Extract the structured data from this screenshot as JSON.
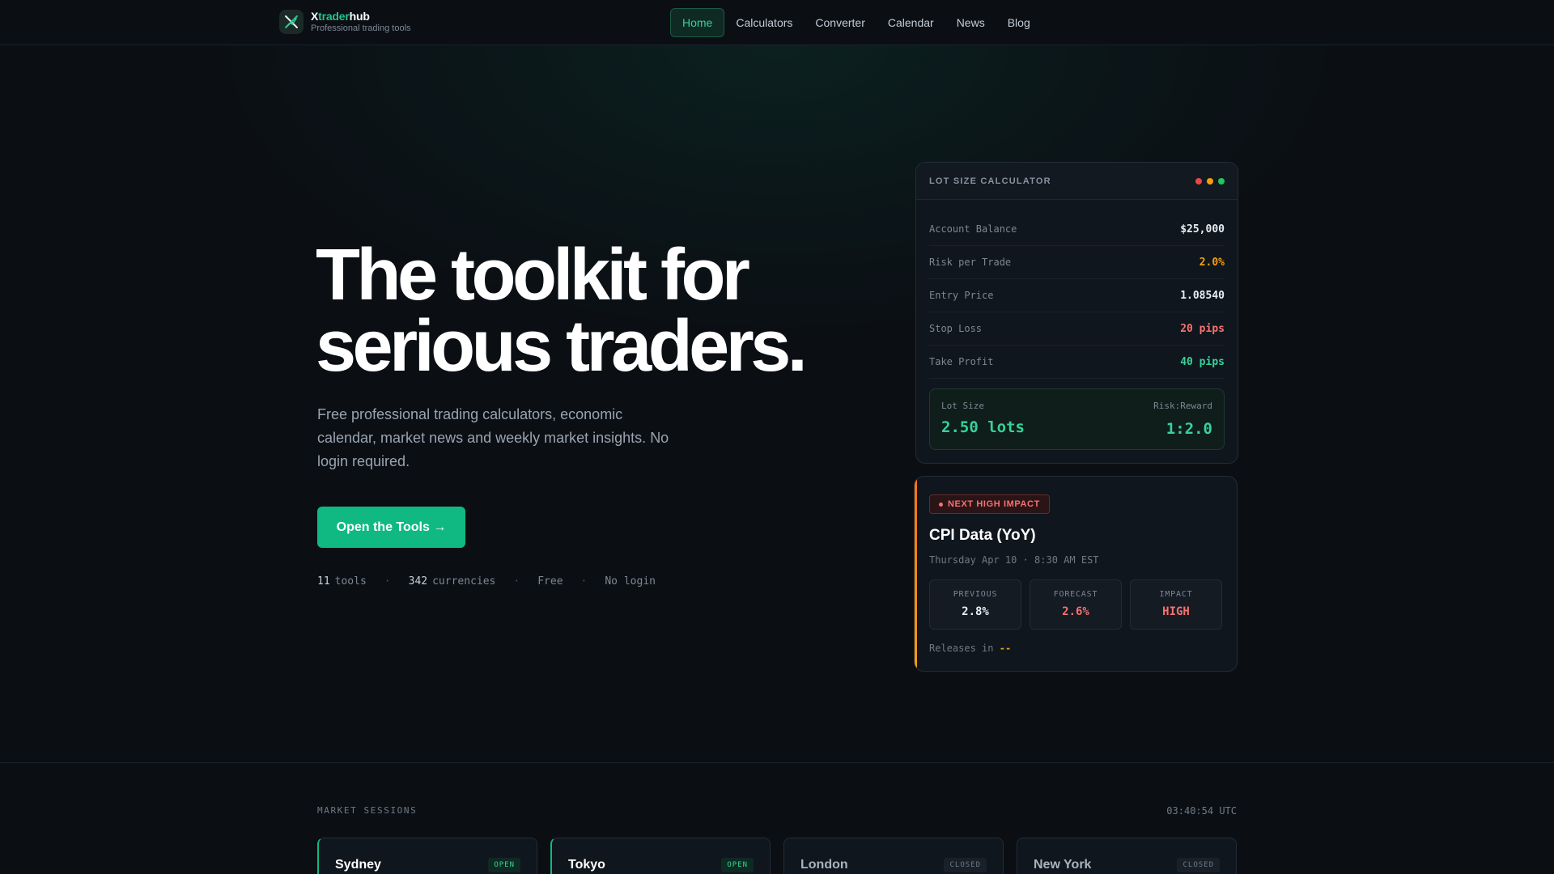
{
  "brand": {
    "name_main": "X",
    "name_accent": "trader",
    "name_end": "hub",
    "tagline": "Professional trading tools"
  },
  "nav": [
    "Home",
    "Calculators",
    "Converter",
    "Calendar",
    "News",
    "Blog"
  ],
  "hero": {
    "title_line1": "The toolkit for",
    "title_line2": "serious traders.",
    "subtitle": "Free professional trading calculators, economic calendar, market news and weekly market insights. No login required.",
    "cta": "Open the Tools →",
    "stats": {
      "tools_num": "11",
      "tools_label": "tools",
      "curr_num": "342",
      "curr_label": "currencies",
      "free": "Free",
      "nologin": "No login",
      "sep": "·"
    }
  },
  "calculator": {
    "title": "LOT SIZE CALCULATOR",
    "rows": [
      {
        "label": "Account Balance",
        "value": "$25,000",
        "color": "#e6edf3"
      },
      {
        "label": "Risk per Trade",
        "value": "2.0%",
        "color": "#f59e0b"
      },
      {
        "label": "Entry Price",
        "value": "1.08540",
        "color": "#e6edf3"
      },
      {
        "label": "Stop Loss",
        "value": "20 pips",
        "color": "#f87171"
      },
      {
        "label": "Take Profit",
        "value": "40 pips",
        "color": "#34d399"
      }
    ],
    "result": {
      "lot_label": "Lot Size",
      "lot_value": "2.50 lots",
      "rr_label": "Risk:Reward",
      "rr_value": "1:2.0"
    },
    "dot_colors": [
      "#ef4444",
      "#f59e0b",
      "#22c55e"
    ]
  },
  "event": {
    "badge": "NEXT HIGH IMPACT",
    "title": "CPI Data (YoY)",
    "date": "Thursday Apr 10 · 8:30 AM EST",
    "boxes": [
      {
        "label": "PREVIOUS",
        "value": "2.8%",
        "color": "#e6edf3"
      },
      {
        "label": "FORECAST",
        "value": "2.6%",
        "color": "#f87171"
      },
      {
        "label": "IMPACT",
        "value": "HIGH",
        "color": "#f87171"
      }
    ],
    "releases_label": "Releases in",
    "releases_value": "--"
  },
  "sessions": {
    "label": "MARKET SESSIONS",
    "time": "03:40:54 UTC",
    "items": [
      {
        "name": "Sydney",
        "status": "OPEN"
      },
      {
        "name": "Tokyo",
        "status": "OPEN"
      },
      {
        "name": "London",
        "status": "CLOSED"
      },
      {
        "name": "New York",
        "status": "CLOSED"
      }
    ]
  }
}
